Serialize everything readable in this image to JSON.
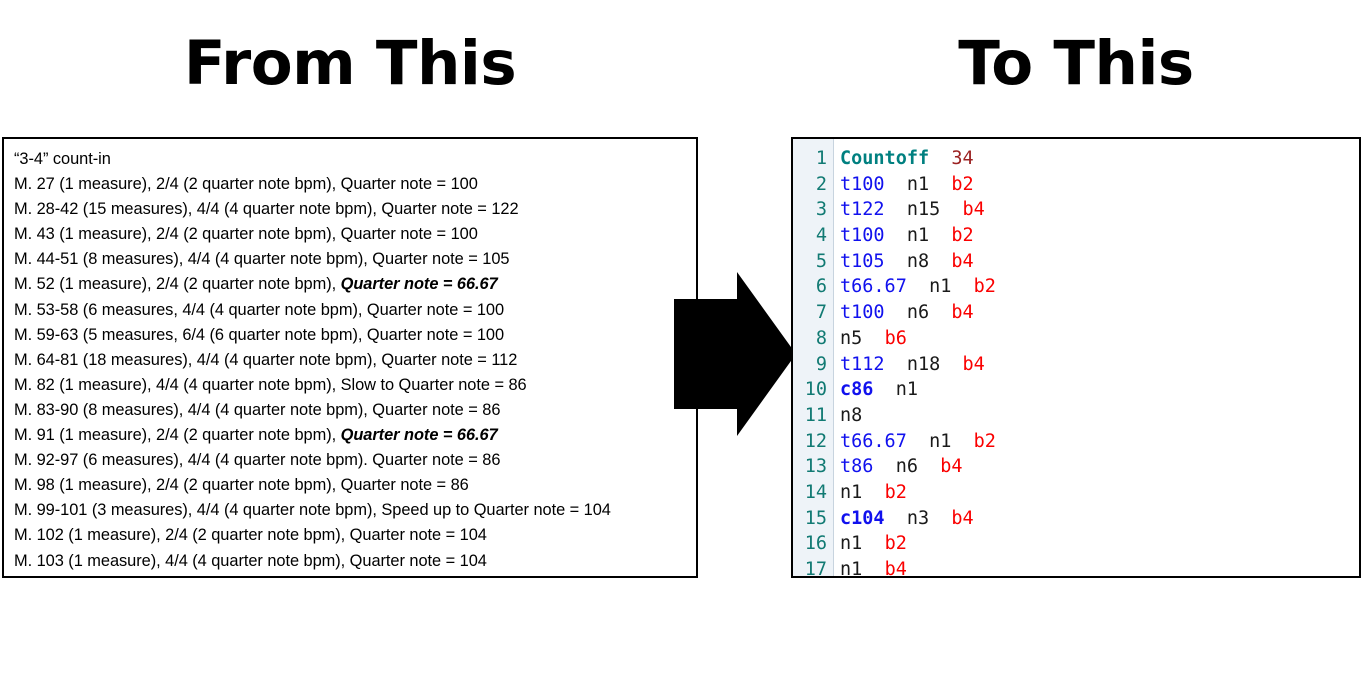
{
  "headings": {
    "left": "From This",
    "right": "To This"
  },
  "arrow": {
    "icon": "right-block-arrow-icon",
    "color": "#000000"
  },
  "source": {
    "lines": [
      {
        "text": "“3-4” count-in",
        "emphasis": ""
      },
      {
        "text": "M. 27 (1 measure), 2/4 (2 quarter note bpm), Quarter note = 100",
        "emphasis": ""
      },
      {
        "text": "M. 28-42 (15 measures), 4/4 (4 quarter note bpm), Quarter note = 122",
        "emphasis": ""
      },
      {
        "text": "M. 43 (1 measure), 2/4 (2 quarter note bpm), Quarter note = 100",
        "emphasis": ""
      },
      {
        "text": "M. 44-51 (8 measures), 4/4 (4 quarter note bpm), Quarter note = 105",
        "emphasis": ""
      },
      {
        "text": "M. 52 (1 measure), 2/4 (2 quarter note bpm), ",
        "emphasis": "Quarter note = 66.67"
      },
      {
        "text": "M. 53-58 (6 measures, 4/4 (4 quarter note bpm), Quarter note = 100",
        "emphasis": ""
      },
      {
        "text": "M. 59-63 (5 measures, 6/4 (6 quarter note bpm), Quarter note = 100",
        "emphasis": ""
      },
      {
        "text": "M. 64-81 (18 measures), 4/4 (4 quarter note bpm), Quarter note = 112",
        "emphasis": ""
      },
      {
        "text": "M. 82 (1 measure), 4/4 (4 quarter note bpm), Slow to Quarter note = 86",
        "emphasis": ""
      },
      {
        "text": "M. 83-90 (8 measures), 4/4 (4 quarter note bpm), Quarter note = 86",
        "emphasis": ""
      },
      {
        "text": "M. 91 (1 measure), 2/4 (2 quarter note bpm), ",
        "emphasis": "Quarter note = 66.67"
      },
      {
        "text": "M. 92-97 (6 measures), 4/4 (4 quarter note bpm). Quarter note = 86",
        "emphasis": ""
      },
      {
        "text": "M. 98 (1 measure), 2/4 (2 quarter note bpm), Quarter note = 86",
        "emphasis": ""
      },
      {
        "text": "M. 99-101 (3 measures), 4/4 (4 quarter note bpm), Speed up to Quarter note = 104",
        "emphasis": ""
      },
      {
        "text": "M. 102 (1 measure), 2/4 (2 quarter note bpm), Quarter note = 104",
        "emphasis": ""
      },
      {
        "text": "M. 103 (1 measure), 4/4 (4 quarter note bpm), Quarter note = 104",
        "emphasis": ""
      }
    ]
  },
  "code": {
    "colors": {
      "line_number": "#117a73",
      "keyword": "#008080",
      "dark_number": "#9b2222",
      "tempo": "#1111ee",
      "command": "#1111ee",
      "note": "#1a1a1a",
      "beat": "#fa0000",
      "gutter_background": "#eef3f8"
    },
    "lines": [
      {
        "number": "1",
        "tokens": [
          {
            "text": "Countoff",
            "type": "kw"
          },
          {
            "text": "34",
            "type": "num-dk"
          }
        ]
      },
      {
        "number": "2",
        "tokens": [
          {
            "text": "t100",
            "type": "tempo"
          },
          {
            "text": "n1",
            "type": "note"
          },
          {
            "text": "b2",
            "type": "beat"
          }
        ]
      },
      {
        "number": "3",
        "tokens": [
          {
            "text": "t122",
            "type": "tempo"
          },
          {
            "text": "n15",
            "type": "note"
          },
          {
            "text": "b4",
            "type": "beat"
          }
        ]
      },
      {
        "number": "4",
        "tokens": [
          {
            "text": "t100",
            "type": "tempo"
          },
          {
            "text": "n1",
            "type": "note"
          },
          {
            "text": "b2",
            "type": "beat"
          }
        ]
      },
      {
        "number": "5",
        "tokens": [
          {
            "text": "t105",
            "type": "tempo"
          },
          {
            "text": "n8",
            "type": "note"
          },
          {
            "text": "b4",
            "type": "beat"
          }
        ]
      },
      {
        "number": "6",
        "tokens": [
          {
            "text": "t66.67",
            "type": "tempo"
          },
          {
            "text": "n1",
            "type": "note"
          },
          {
            "text": "b2",
            "type": "beat"
          }
        ]
      },
      {
        "number": "7",
        "tokens": [
          {
            "text": "t100",
            "type": "tempo"
          },
          {
            "text": "n6",
            "type": "note"
          },
          {
            "text": "b4",
            "type": "beat"
          }
        ]
      },
      {
        "number": "8",
        "tokens": [
          {
            "text": "n5",
            "type": "note"
          },
          {
            "text": "b6",
            "type": "beat"
          }
        ]
      },
      {
        "number": "9",
        "tokens": [
          {
            "text": "t112",
            "type": "tempo"
          },
          {
            "text": "n18",
            "type": "note"
          },
          {
            "text": "b4",
            "type": "beat"
          }
        ]
      },
      {
        "number": "10",
        "tokens": [
          {
            "text": "c86",
            "type": "cmd"
          },
          {
            "text": "n1",
            "type": "note"
          }
        ]
      },
      {
        "number": "11",
        "tokens": [
          {
            "text": "n8",
            "type": "note"
          }
        ]
      },
      {
        "number": "12",
        "tokens": [
          {
            "text": "t66.67",
            "type": "tempo"
          },
          {
            "text": "n1",
            "type": "note"
          },
          {
            "text": "b2",
            "type": "beat"
          }
        ]
      },
      {
        "number": "13",
        "tokens": [
          {
            "text": "t86",
            "type": "tempo"
          },
          {
            "text": "n6",
            "type": "note"
          },
          {
            "text": "b4",
            "type": "beat"
          }
        ]
      },
      {
        "number": "14",
        "tokens": [
          {
            "text": "n1",
            "type": "note"
          },
          {
            "text": "b2",
            "type": "beat"
          }
        ]
      },
      {
        "number": "15",
        "tokens": [
          {
            "text": "c104",
            "type": "cmd"
          },
          {
            "text": "n3",
            "type": "note"
          },
          {
            "text": "b4",
            "type": "beat"
          }
        ]
      },
      {
        "number": "16",
        "tokens": [
          {
            "text": "n1",
            "type": "note"
          },
          {
            "text": "b2",
            "type": "beat"
          }
        ]
      },
      {
        "number": "17",
        "tokens": [
          {
            "text": "n1",
            "type": "note"
          },
          {
            "text": "b4",
            "type": "beat"
          }
        ]
      }
    ]
  }
}
